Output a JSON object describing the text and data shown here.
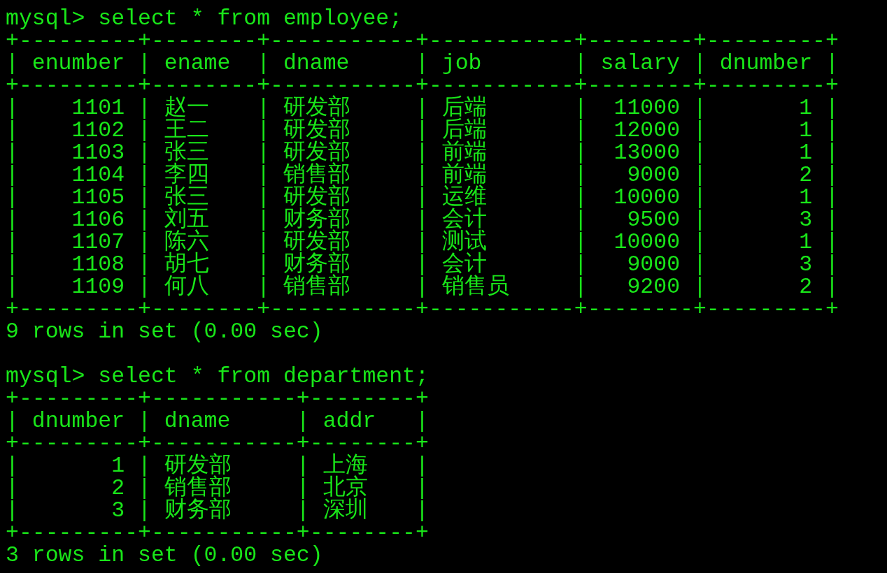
{
  "sessions": [
    {
      "command_line": "mysql> select * from employee;",
      "table": {
        "separator": "|",
        "borders": [
          "+---------+--------+-----------+-----------+--------+---------+",
          "+---------+--------+-----------+-----------+--------+---------+",
          "+---------+--------+-----------+-----------+--------+---------+"
        ],
        "columns": [
          {
            "label": "enumber",
            "kind": "numeric"
          },
          {
            "label": "ename",
            "kind": "text"
          },
          {
            "label": "dname",
            "kind": "text"
          },
          {
            "label": "job",
            "kind": "text"
          },
          {
            "label": "salary",
            "kind": "numeric"
          },
          {
            "label": "dnumber",
            "kind": "numeric"
          }
        ],
        "rows": [
          [
            "1101",
            "赵一",
            "研发部",
            "后端",
            "11000",
            "1"
          ],
          [
            "1102",
            "王二",
            "研发部",
            "后端",
            "12000",
            "1"
          ],
          [
            "1103",
            "张三",
            "研发部",
            "前端",
            "13000",
            "1"
          ],
          [
            "1104",
            "李四",
            "销售部",
            "前端",
            "9000",
            "2"
          ],
          [
            "1105",
            "张三",
            "研发部",
            "运维",
            "10000",
            "1"
          ],
          [
            "1106",
            "刘五",
            "财务部",
            "会计",
            "9500",
            "3"
          ],
          [
            "1107",
            "陈六",
            "研发部",
            "测试",
            "10000",
            "1"
          ],
          [
            "1108",
            "胡七",
            "财务部",
            "会计",
            "9000",
            "3"
          ],
          [
            "1109",
            "何八",
            "销售部",
            "销售员",
            "9200",
            "2"
          ]
        ]
      },
      "result": "9 rows in set (0.00 sec)"
    },
    {
      "command_line": "mysql> select * from department;",
      "table": {
        "separator": "|",
        "borders": [
          "+---------+-----------+--------+",
          "+---------+-----------+--------+",
          "+---------+-----------+--------+"
        ],
        "columns": [
          {
            "label": "dnumber",
            "kind": "numeric"
          },
          {
            "label": "dname",
            "kind": "text"
          },
          {
            "label": "addr",
            "kind": "text"
          }
        ],
        "rows": [
          [
            "1",
            "研发部",
            "上海"
          ],
          [
            "2",
            "销售部",
            "北京"
          ],
          [
            "3",
            "财务部",
            "深圳"
          ]
        ]
      },
      "result": "3 rows in set (0.00 sec)"
    }
  ]
}
